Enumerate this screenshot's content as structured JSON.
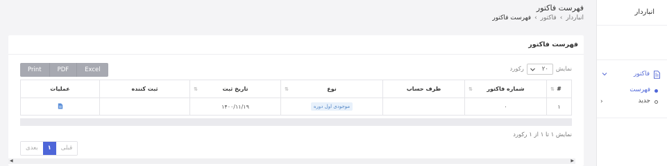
{
  "sidebar": {
    "title": "انباردار",
    "menu_label": "فاکتور",
    "sub_items": [
      {
        "label": "فهرست",
        "active": true
      },
      {
        "label": "جدید",
        "active": false
      }
    ]
  },
  "header": {
    "title": "فهرست فاکتور",
    "breadcrumb": [
      "انباردار",
      "فاکتور",
      "فهرست فاکتور"
    ]
  },
  "card": {
    "title": "فهرست فاکتور",
    "buttons": [
      "Print",
      "PDF",
      "Excel"
    ],
    "show_label": "نمایش",
    "page_length": "۲۰",
    "records_label": "رکورد",
    "columns": [
      "#",
      "شماره فاکتور",
      "طرف حساب",
      "نوع",
      "تاریخ ثبت",
      "ثبت کننده",
      "عملیات"
    ],
    "rows": [
      {
        "index": "۱",
        "number": "۰",
        "account": "",
        "type": "موجودی اول دوره",
        "date": "۱۴۰۰/۱۱/۱۹",
        "creator": ""
      }
    ],
    "info": "نمایش ۱ تا ۱ از ۱ رکورد",
    "pagination": {
      "prev": "قبلی",
      "current": "۱",
      "next": "بعدی"
    }
  },
  "colors": {
    "accent": "#4e66d8",
    "button": "#a7a9b1"
  }
}
